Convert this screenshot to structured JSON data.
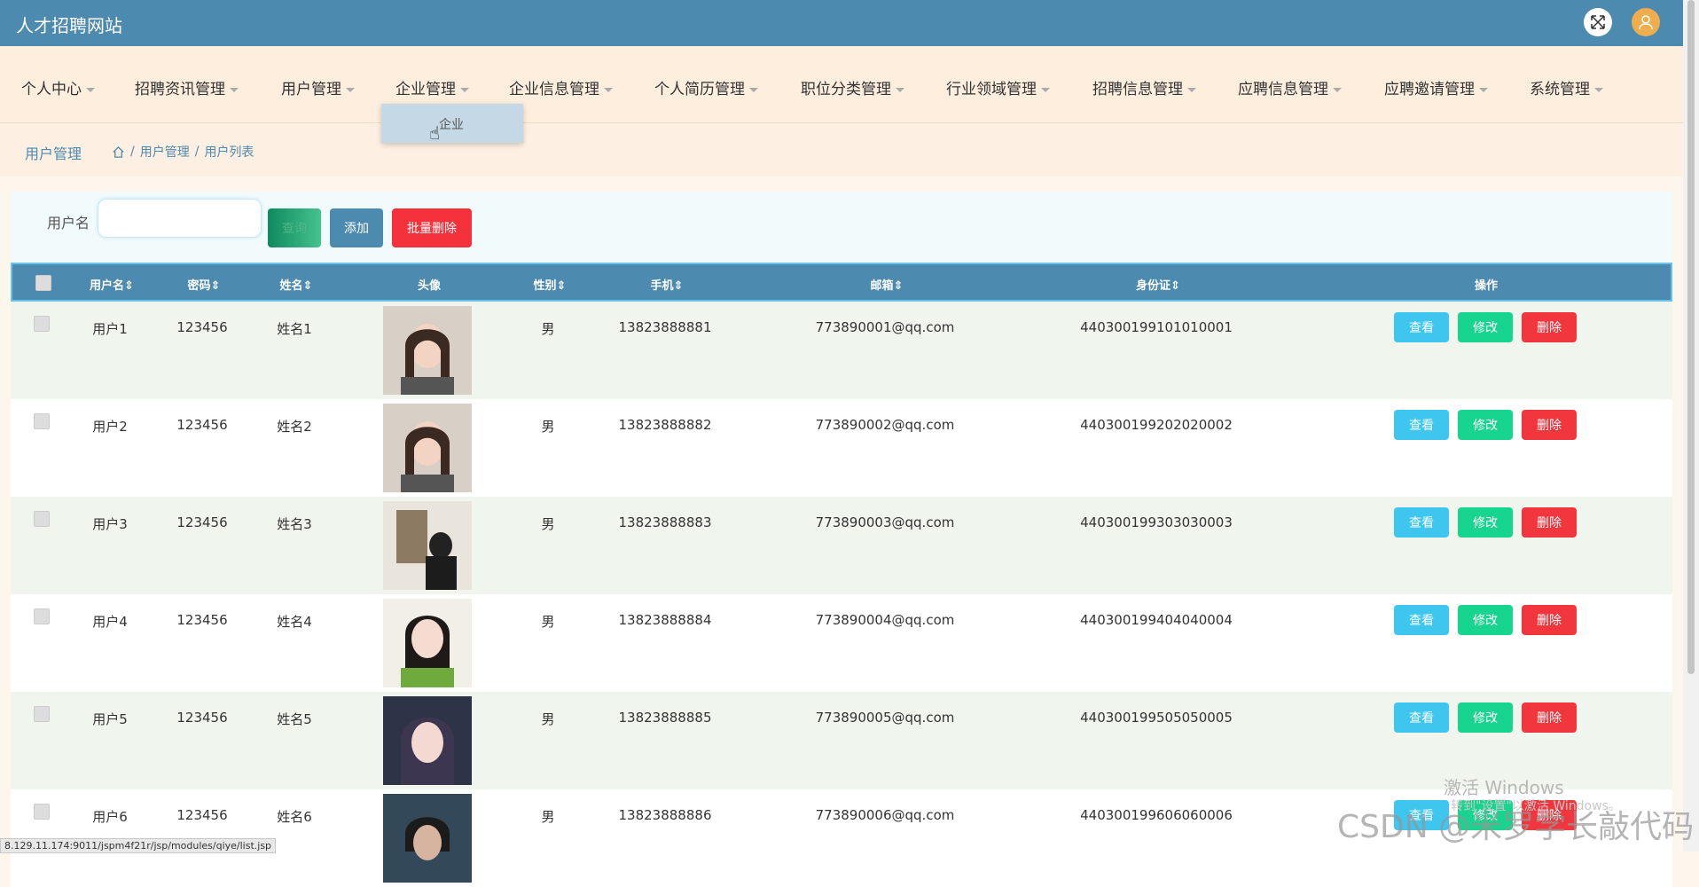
{
  "app_title": "人才招聘网站",
  "menu": [
    {
      "label": "个人中心"
    },
    {
      "label": "招聘资讯管理"
    },
    {
      "label": "用户管理"
    },
    {
      "label": "企业管理"
    },
    {
      "label": "企业信息管理"
    },
    {
      "label": "个人简历管理"
    },
    {
      "label": "职位分类管理"
    },
    {
      "label": "行业领域管理"
    },
    {
      "label": "招聘信息管理"
    },
    {
      "label": "应聘信息管理"
    },
    {
      "label": "应聘邀请管理"
    },
    {
      "label": "系统管理"
    }
  ],
  "dropdown_item": "企业",
  "breadcrumb": {
    "title": "用户管理",
    "sep": "/",
    "path": [
      "用户管理",
      "用户列表"
    ]
  },
  "search": {
    "label": "用户名",
    "value": "",
    "search_btn": "查询",
    "add_btn": "添加",
    "batch_delete_btn": "批量删除"
  },
  "table": {
    "headers": [
      "用户名",
      "密码",
      "姓名",
      "头像",
      "性别",
      "手机",
      "邮箱",
      "身份证",
      "操作"
    ],
    "actions": {
      "view": "查看",
      "edit": "修改",
      "delete": "删除"
    },
    "rows": [
      {
        "username": "用户1",
        "password": "123456",
        "name": "姓名1",
        "gender": "男",
        "phone": "13823888881",
        "email": "773890001@qq.com",
        "idcard": "440300199101010001"
      },
      {
        "username": "用户2",
        "password": "123456",
        "name": "姓名2",
        "gender": "男",
        "phone": "13823888882",
        "email": "773890002@qq.com",
        "idcard": "440300199202020002"
      },
      {
        "username": "用户3",
        "password": "123456",
        "name": "姓名3",
        "gender": "男",
        "phone": "13823888883",
        "email": "773890003@qq.com",
        "idcard": "440300199303030003"
      },
      {
        "username": "用户4",
        "password": "123456",
        "name": "姓名4",
        "gender": "男",
        "phone": "13823888884",
        "email": "773890004@qq.com",
        "idcard": "440300199404040004"
      },
      {
        "username": "用户5",
        "password": "123456",
        "name": "姓名5",
        "gender": "男",
        "phone": "13823888885",
        "email": "773890005@qq.com",
        "idcard": "440300199505050005"
      },
      {
        "username": "用户6",
        "password": "123456",
        "name": "姓名6",
        "gender": "男",
        "phone": "13823888886",
        "email": "773890006@qq.com",
        "idcard": "440300199606060006"
      }
    ]
  },
  "status_url": "8.129.11.174:9011/jspm4f21r/jsp/modules/qiye/list.jsp",
  "watermark": {
    "activate": "激活 Windows",
    "activate_sub": "转到\"设置\"以激活 Windows。",
    "csdn": "CSDN @米罗学长敲代码"
  }
}
